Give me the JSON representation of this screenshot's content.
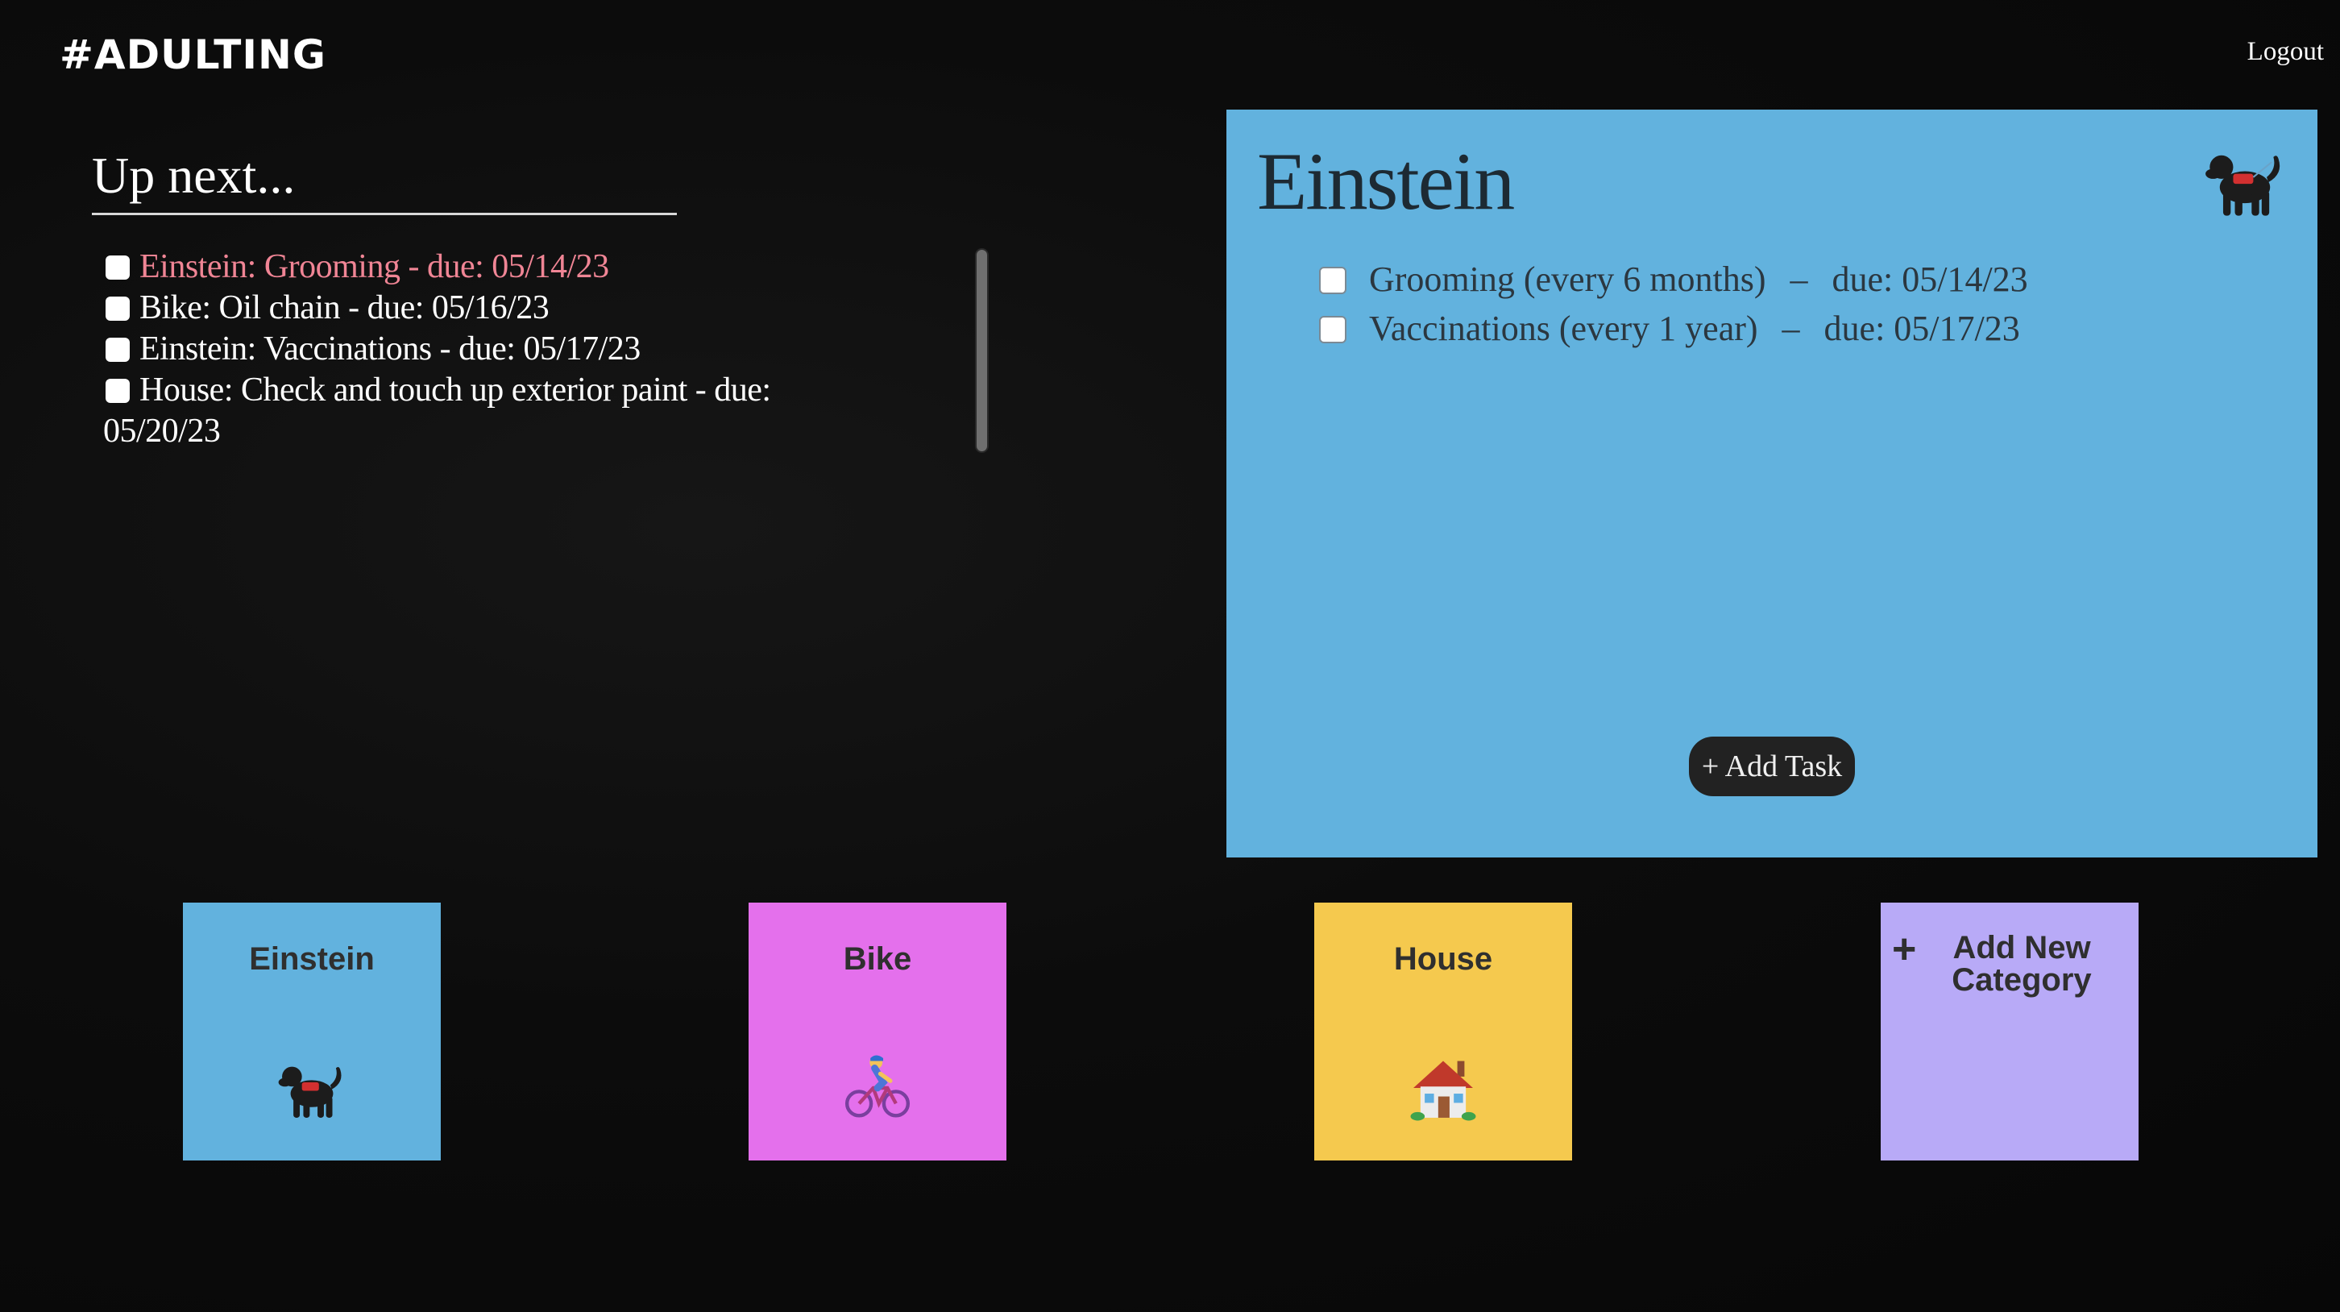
{
  "header": {
    "logo": "#ADULTING",
    "logout_label": "Logout"
  },
  "up_next": {
    "title": "Up next...",
    "items": [
      {
        "text": "Einstein: Grooming - due: 05/14/23",
        "urgent": true
      },
      {
        "text": "Bike: Oil chain - due: 05/16/23",
        "urgent": false
      },
      {
        "text": "Einstein: Vaccinations - due: 05/17/23",
        "urgent": false
      },
      {
        "text": "House: Check and touch up exterior paint - due: 05/20/23",
        "urgent": false
      }
    ]
  },
  "detail": {
    "title": "Einstein",
    "icon": "service-dog-icon",
    "color": "#62b2de",
    "tasks": [
      {
        "name": "Grooming (every 6 months)",
        "sep": "–",
        "due": "due: 05/14/23"
      },
      {
        "name": "Vaccinations (every 1 year)",
        "sep": "–",
        "due": "due: 05/17/23"
      }
    ],
    "add_task_label": "+ Add Task"
  },
  "categories": [
    {
      "label": "Einstein",
      "icon": "service-dog-icon",
      "color": "#62b2de"
    },
    {
      "label": "Bike",
      "icon": "cyclist-icon",
      "color": "#e470ec"
    },
    {
      "label": "House",
      "icon": "house-icon",
      "color": "#f5c94e"
    }
  ],
  "add_category": {
    "plus": "+",
    "label": "Add New Category",
    "color": "#b8aaf7"
  },
  "colors": {
    "background": "#0c0c0c",
    "urgent_text": "#f08595",
    "button_dark": "#222222"
  }
}
